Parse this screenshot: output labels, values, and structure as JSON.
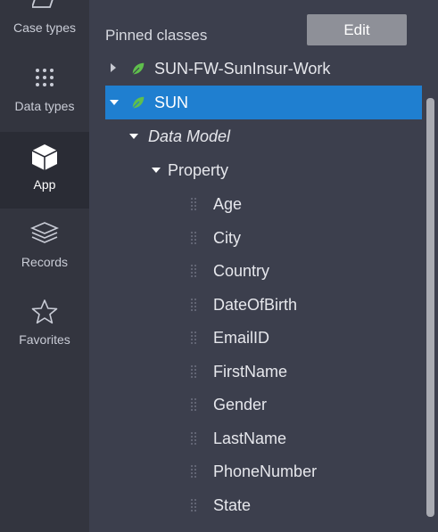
{
  "rail": {
    "items": [
      {
        "label": "Case types",
        "icon": "case-types-icon"
      },
      {
        "label": "Data types",
        "icon": "data-types-icon"
      },
      {
        "label": "App",
        "icon": "app-cube-icon"
      },
      {
        "label": "Records",
        "icon": "records-stack-icon"
      },
      {
        "label": "Favorites",
        "icon": "favorites-star-icon"
      }
    ]
  },
  "panel": {
    "title": "Pinned classes",
    "edit_label": "Edit",
    "tree": {
      "class_collapsed": "SUN-FW-SunInsur-Work",
      "class_selected": "SUN",
      "data_model": "Data Model",
      "property": "Property",
      "properties": [
        "Age",
        "City",
        "Country",
        "DateOfBirth",
        "EmailID",
        "FirstName",
        "Gender",
        "LastName",
        "PhoneNumber",
        "State"
      ]
    }
  },
  "colors": {
    "rail_bg": "#33353f",
    "panel_bg": "#3c3f4d",
    "selection": "#1f7fd0",
    "leaf": "#5fbf4c",
    "edit_button": "#8e9098"
  }
}
